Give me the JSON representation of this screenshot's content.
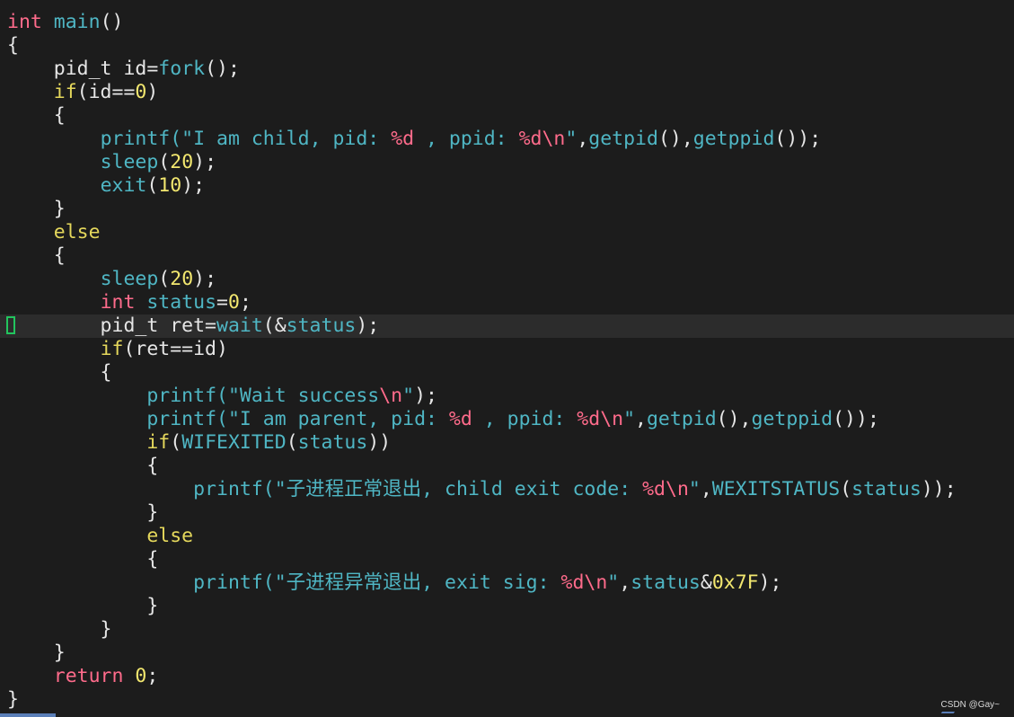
{
  "editor": {
    "lines": [
      [
        [
          "int",
          "type"
        ],
        [
          " ",
          "plain"
        ],
        [
          "main",
          "func"
        ],
        [
          "()",
          "punct"
        ]
      ],
      [
        [
          "{",
          "punct"
        ]
      ],
      [
        [
          "    pid_t id=",
          "plain"
        ],
        [
          "fork",
          "func"
        ],
        [
          "();",
          "punct"
        ]
      ],
      [
        [
          "    ",
          "plain"
        ],
        [
          "if",
          "kw"
        ],
        [
          "(id==",
          "plain"
        ],
        [
          "0",
          "num"
        ],
        [
          ")",
          "punct"
        ]
      ],
      [
        [
          "    {",
          "punct"
        ]
      ],
      [
        [
          "        ",
          "plain"
        ],
        [
          "printf",
          "func"
        ],
        [
          "(\"I am child, pid: ",
          "str"
        ],
        [
          "%d",
          "fmt"
        ],
        [
          " , ppid: ",
          "str"
        ],
        [
          "%d",
          "fmt"
        ],
        [
          "\\n",
          "esc"
        ],
        [
          "\"",
          "str"
        ],
        [
          ",",
          "punct"
        ],
        [
          "getpid",
          "func"
        ],
        [
          "(),",
          "punct"
        ],
        [
          "getppid",
          "func"
        ],
        [
          "());",
          "punct"
        ]
      ],
      [
        [
          "        ",
          "plain"
        ],
        [
          "sleep",
          "func"
        ],
        [
          "(",
          "punct"
        ],
        [
          "20",
          "num"
        ],
        [
          ");",
          "punct"
        ]
      ],
      [
        [
          "        ",
          "plain"
        ],
        [
          "exit",
          "func"
        ],
        [
          "(",
          "punct"
        ],
        [
          "10",
          "num"
        ],
        [
          ");",
          "punct"
        ]
      ],
      [
        [
          "    }",
          "punct"
        ]
      ],
      [
        [
          "    ",
          "plain"
        ],
        [
          "else",
          "kw"
        ]
      ],
      [
        [
          "    {",
          "punct"
        ]
      ],
      [
        [
          "        ",
          "plain"
        ],
        [
          "sleep",
          "func"
        ],
        [
          "(",
          "punct"
        ],
        [
          "20",
          "num"
        ],
        [
          ");",
          "punct"
        ]
      ],
      [
        [
          "        ",
          "plain"
        ],
        [
          "int",
          "type"
        ],
        [
          " ",
          "plain"
        ],
        [
          "status",
          "var"
        ],
        [
          "=",
          "punct"
        ],
        [
          "0",
          "num"
        ],
        [
          ";",
          "punct"
        ]
      ],
      [
        [
          "        pid_t ret=",
          "plain"
        ],
        [
          "wait",
          "func"
        ],
        [
          "(&",
          "punct"
        ],
        [
          "status",
          "var"
        ],
        [
          ");",
          "punct"
        ]
      ],
      [
        [
          "        ",
          "plain"
        ],
        [
          "if",
          "kw"
        ],
        [
          "(ret==id)",
          "plain"
        ]
      ],
      [
        [
          "        {",
          "punct"
        ]
      ],
      [
        [
          "            ",
          "plain"
        ],
        [
          "printf",
          "func"
        ],
        [
          "(\"Wait success",
          "str"
        ],
        [
          "\\n",
          "esc"
        ],
        [
          "\"",
          "str"
        ],
        [
          ");",
          "punct"
        ]
      ],
      [
        [
          "            ",
          "plain"
        ],
        [
          "printf",
          "func"
        ],
        [
          "(\"I am parent, pid: ",
          "str"
        ],
        [
          "%d",
          "fmt"
        ],
        [
          " , ppid: ",
          "str"
        ],
        [
          "%d",
          "fmt"
        ],
        [
          "\\n",
          "esc"
        ],
        [
          "\"",
          "str"
        ],
        [
          ",",
          "punct"
        ],
        [
          "getpid",
          "func"
        ],
        [
          "(),",
          "punct"
        ],
        [
          "getppid",
          "func"
        ],
        [
          "());",
          "punct"
        ]
      ],
      [
        [
          "            ",
          "plain"
        ],
        [
          "if",
          "kw"
        ],
        [
          "(",
          "punct"
        ],
        [
          "WIFEXITED",
          "macro"
        ],
        [
          "(",
          "punct"
        ],
        [
          "status",
          "var"
        ],
        [
          "))",
          "punct"
        ]
      ],
      [
        [
          "            {",
          "punct"
        ]
      ],
      [
        [
          "                ",
          "plain"
        ],
        [
          "printf",
          "func"
        ],
        [
          "(\"子进程正常退出, child exit code: ",
          "str"
        ],
        [
          "%d",
          "fmt"
        ],
        [
          "\\n",
          "esc"
        ],
        [
          "\"",
          "str"
        ],
        [
          ",",
          "punct"
        ],
        [
          "WEXITSTATUS",
          "macro"
        ],
        [
          "(",
          "punct"
        ],
        [
          "status",
          "var"
        ],
        [
          "));",
          "punct"
        ]
      ],
      [
        [
          "            }",
          "punct"
        ]
      ],
      [
        [
          "            ",
          "plain"
        ],
        [
          "else",
          "kw"
        ]
      ],
      [
        [
          "            {",
          "punct"
        ]
      ],
      [
        [
          "                ",
          "plain"
        ],
        [
          "printf",
          "func"
        ],
        [
          "(\"子进程异常退出, exit sig: ",
          "str"
        ],
        [
          "%d",
          "fmt"
        ],
        [
          "\\n",
          "esc"
        ],
        [
          "\"",
          "str"
        ],
        [
          ",",
          "punct"
        ],
        [
          "status",
          "var"
        ],
        [
          "&",
          "punct"
        ],
        [
          "0x7F",
          "num"
        ],
        [
          ");",
          "punct"
        ]
      ],
      [
        [
          "            }",
          "punct"
        ]
      ],
      [
        [
          "        }",
          "punct"
        ]
      ],
      [
        [
          "    }",
          "punct"
        ]
      ],
      [
        [
          "    ",
          "plain"
        ],
        [
          "return",
          "type"
        ],
        [
          " ",
          "plain"
        ],
        [
          "0",
          "num"
        ],
        [
          ";",
          "punct"
        ]
      ],
      [
        [
          "}",
          "punct"
        ]
      ]
    ],
    "current_line_index": 13
  },
  "watermark": "CSDN @Gay~",
  "colors": {
    "background": "#1c1c1c",
    "current_line": "#2c2c2c",
    "cursor": "#22c55e",
    "type": "#ff6b8b",
    "function": "#4fb6c4",
    "keyword": "#e5d85c",
    "number": "#f2e76f"
  }
}
